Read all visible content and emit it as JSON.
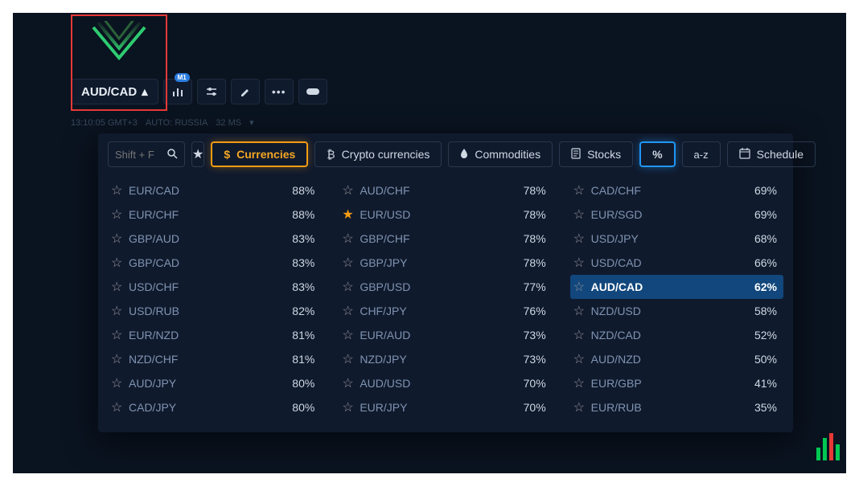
{
  "toolbar": {
    "symbol": "AUD/CAD",
    "chart_badge": "M1"
  },
  "status": {
    "time": "13:10:05 GMT+3",
    "server": "AUTO: RUSSIA",
    "latency": "32 MS"
  },
  "search": {
    "placeholder": "Shift + F"
  },
  "categories": {
    "currencies": "Currencies",
    "crypto": "Crypto currencies",
    "commodities": "Commodities",
    "stocks": "Stocks",
    "percent": "%",
    "sort": "a-z",
    "schedule": "Schedule"
  },
  "selected_asset": "AUD/CAD",
  "columns": [
    [
      {
        "name": "EUR/CAD",
        "pct": "88%",
        "fav": false
      },
      {
        "name": "EUR/CHF",
        "pct": "88%",
        "fav": false
      },
      {
        "name": "GBP/AUD",
        "pct": "83%",
        "fav": false
      },
      {
        "name": "GBP/CAD",
        "pct": "83%",
        "fav": false
      },
      {
        "name": "USD/CHF",
        "pct": "83%",
        "fav": false
      },
      {
        "name": "USD/RUB",
        "pct": "82%",
        "fav": false
      },
      {
        "name": "EUR/NZD",
        "pct": "81%",
        "fav": false
      },
      {
        "name": "NZD/CHF",
        "pct": "81%",
        "fav": false
      },
      {
        "name": "AUD/JPY",
        "pct": "80%",
        "fav": false
      },
      {
        "name": "CAD/JPY",
        "pct": "80%",
        "fav": false
      }
    ],
    [
      {
        "name": "AUD/CHF",
        "pct": "78%",
        "fav": false
      },
      {
        "name": "EUR/USD",
        "pct": "78%",
        "fav": true
      },
      {
        "name": "GBP/CHF",
        "pct": "78%",
        "fav": false
      },
      {
        "name": "GBP/JPY",
        "pct": "78%",
        "fav": false
      },
      {
        "name": "GBP/USD",
        "pct": "77%",
        "fav": false
      },
      {
        "name": "CHF/JPY",
        "pct": "76%",
        "fav": false
      },
      {
        "name": "EUR/AUD",
        "pct": "73%",
        "fav": false
      },
      {
        "name": "NZD/JPY",
        "pct": "73%",
        "fav": false
      },
      {
        "name": "AUD/USD",
        "pct": "70%",
        "fav": false
      },
      {
        "name": "EUR/JPY",
        "pct": "70%",
        "fav": false
      }
    ],
    [
      {
        "name": "CAD/CHF",
        "pct": "69%",
        "fav": false
      },
      {
        "name": "EUR/SGD",
        "pct": "69%",
        "fav": false
      },
      {
        "name": "USD/JPY",
        "pct": "68%",
        "fav": false
      },
      {
        "name": "USD/CAD",
        "pct": "66%",
        "fav": false
      },
      {
        "name": "AUD/CAD",
        "pct": "62%",
        "fav": false
      },
      {
        "name": "NZD/USD",
        "pct": "58%",
        "fav": false
      },
      {
        "name": "NZD/CAD",
        "pct": "52%",
        "fav": false
      },
      {
        "name": "AUD/NZD",
        "pct": "50%",
        "fav": false
      },
      {
        "name": "EUR/GBP",
        "pct": "41%",
        "fav": false
      },
      {
        "name": "EUR/RUB",
        "pct": "35%",
        "fav": false
      }
    ]
  ]
}
